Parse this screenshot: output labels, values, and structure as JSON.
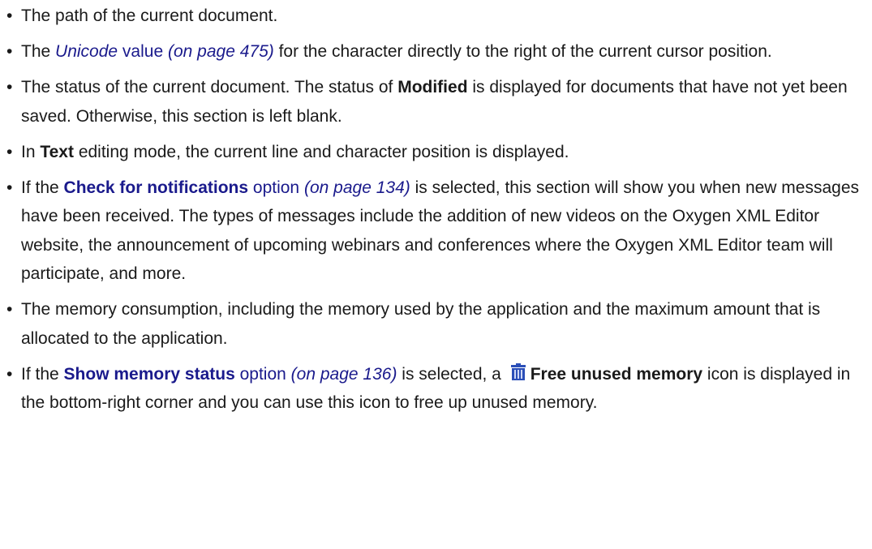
{
  "items": [
    {
      "text": "The path of the current document."
    },
    {
      "pre": "The ",
      "link_word": "Unicode",
      "link_rest": " value",
      "ref": "(on page 475)",
      "post": " for the character directly to the right of the current cursor position."
    },
    {
      "pre": "The status of the current document. The status of ",
      "bold": "Modified",
      "post": " is displayed for documents that have not yet been saved. Otherwise, this section is left blank."
    },
    {
      "pre": "In ",
      "bold": "Text",
      "post": " editing mode, the current line and character position is displayed."
    },
    {
      "pre": "If the ",
      "link_bold": "Check for notifications",
      "link_rest": " option",
      "ref": "(on page 134)",
      "post": " is selected, this section will show you when new messages have been received. The types of messages include the addition of new videos on the Oxygen XML Editor website, the announcement of upcoming webinars and conferences where the Oxygen XML Editor team will participate, and more."
    },
    {
      "text": "The memory consumption, including the memory used by the application and the maximum amount that is allocated to the application."
    },
    {
      "pre": "If the ",
      "link_bold": "Show memory status",
      "link_rest": " option",
      "ref": "(on page 136)",
      "mid": " is selected, a ",
      "icon": "trash-icon",
      "bold": "Free unused memory",
      "post": " icon is displayed in the bottom-right corner and you can use this icon to free up unused memory."
    }
  ],
  "colors": {
    "link": "#1a1a8c",
    "text": "#1a1a1a",
    "icon_blue": "#2b4fb8"
  }
}
